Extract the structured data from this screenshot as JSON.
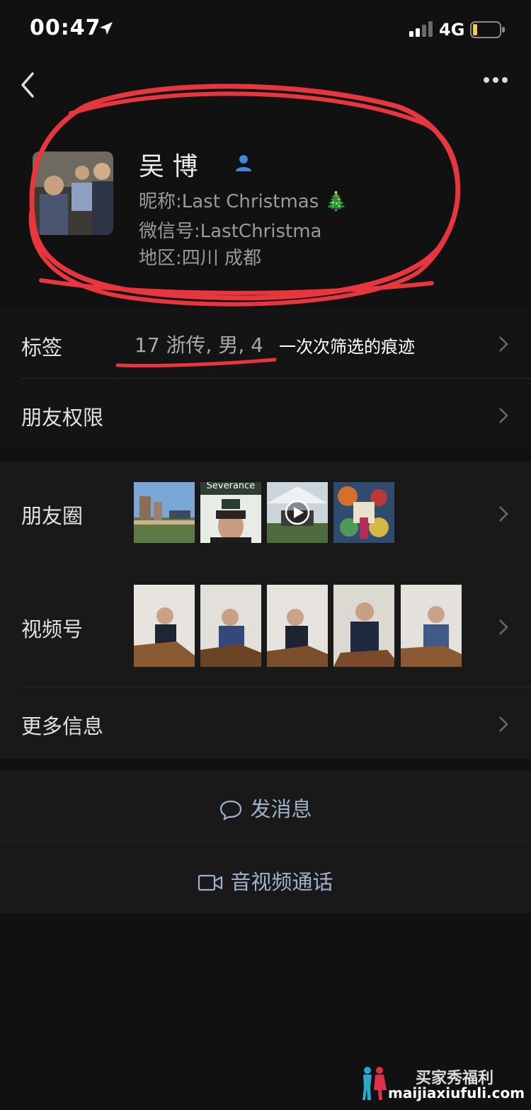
{
  "status_bar": {
    "time": "00:47",
    "network": "4G"
  },
  "profile": {
    "name": "吴  博",
    "nickname_label": "昵称:",
    "nickname": "Last Christmas 🎄",
    "wechat_id_label": "微信号:",
    "wechat_id": "LastChristma",
    "region_label": "地区:",
    "region": "四川 成都"
  },
  "rows": {
    "tags_label": "标签",
    "tags_value": "17 浙传, 男, 4",
    "tags_note": "一次次筛选的痕迹",
    "permissions_label": "朋友权限",
    "moments_label": "朋友圈",
    "moments_thumb_text": "Severance",
    "channels_label": "视频号",
    "more_info_label": "更多信息"
  },
  "actions": {
    "message": "发消息",
    "call": "音视频通话"
  },
  "watermark": {
    "title": "买家秀福利",
    "url": "maijiaxiufuli.com"
  },
  "colors": {
    "background": "#111111",
    "panel": "#191919",
    "annotation": "#e8363f",
    "action_text": "#9fb2cc"
  }
}
